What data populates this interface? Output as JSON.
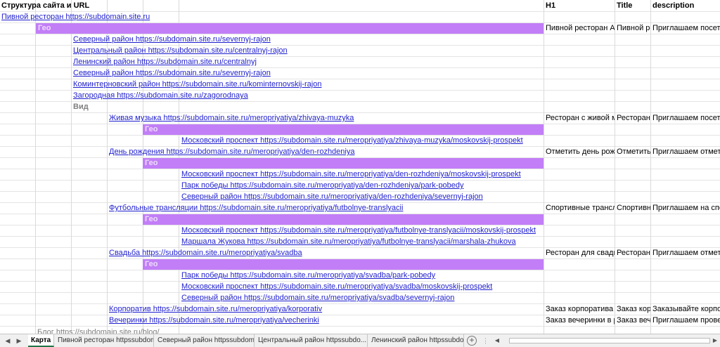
{
  "header": {
    "structure": "Структура сайта и URL",
    "h1": "H1",
    "title": "Title",
    "description": "description"
  },
  "root": {
    "link": "Пивной ресторан https://subdomain.site.ru",
    "geo_label": "Гео",
    "h1": "Пивной ресторан Ав",
    "title": "Пивной ре",
    "description": "Приглашаем посети"
  },
  "geo_links": [
    "Северный район https://subdomain.site.ru/severnyj-rajon",
    "Центральный район https://subdomain.site.ru/centralnyj-rajon",
    "Ленинский район https://subdomain.site.ru/centralnyj",
    "Северный район https://subdomain.site.ru/severnyj-rajon",
    "Коминтерновский район https://subdomain.site.ru/kominternovskij-rajon",
    "Загородная https://subdomain.site.ru/zagorodnaya"
  ],
  "vid_label": "Вид",
  "events": [
    {
      "link": "Живая музыка https://subdomain.site.ru/meropriyatiya/zhivaya-muzyka",
      "h1": "Ресторан с живой м",
      "title": "Ресторан",
      "description": "Приглашаем посети",
      "geo_label": "Гео",
      "geo": [
        "Московский проспект https://subdomain.site.ru/meropriyatiya/zhivaya-muzyka/moskovskij-prospekt"
      ]
    },
    {
      "link": "День рождения https://subdomain.site.ru/meropriyatiya/den-rozhdeniya",
      "h1": "Отметить день рож",
      "title": "Отметить",
      "description": "Приглашаем отмет",
      "geo_label": "Гео",
      "geo": [
        "Московский проспект https://subdomain.site.ru/meropriyatiya/den-rozhdeniya/moskovskij-prospekt",
        "Парк победы https://subdomain.site.ru/meropriyatiya/den-rozhdeniya/park-pobedy",
        "Северный район https://subdomain.site.ru/meropriyatiya/den-rozhdeniya/severnyj-rajon"
      ]
    },
    {
      "link": "Футбольные трансляции https://subdomain.site.ru/meropriyatiya/futbolnye-translyacii",
      "h1": "Спортивные трансл",
      "title": "Спортивн",
      "description": "Приглашаем на спо",
      "geo_label": "Гео",
      "geo": [
        "Московский проспект https://subdomain.site.ru/meropriyatiya/futbolnye-translyacii/moskovskij-prospekt",
        "Маршала Жукова https://subdomain.site.ru/meropriyatiya/futbolnye-translyacii/marshala-zhukova"
      ]
    },
    {
      "link": "Свадьба https://subdomain.site.ru/meropriyatiya/svadba",
      "h1": "Ресторан для свадь",
      "title": "Ресторан ,",
      "description": "Приглашаем отмет",
      "geo_label": "Гео",
      "geo": [
        "Парк победы https://subdomain.site.ru/meropriyatiya/svadba/park-pobedy",
        "Московский проспект https://subdomain.site.ru/meropriyatiya/svadba/moskovskij-prospekt",
        "Северный район https://subdomain.site.ru/meropriyatiya/svadba/severnyj-rajon"
      ]
    },
    {
      "link": "Корпоратив https://subdomain.site.ru/meropriyatiya/korporativ",
      "h1": "Заказ корпоратива в",
      "title": "Заказ кор",
      "description": "Заказывайте корпо"
    },
    {
      "link": "Вечеринки https://subdomain.site.ru/meropriyatiya/vecherinki",
      "h1": "Заказ вечеринки в р",
      "title": "Заказ веч",
      "description": "Приглашаем прове"
    }
  ],
  "blog_partial": "Блог https://subdomain.site.ru/blog/",
  "tabs": [
    "Карта",
    "Пивной ресторан httpssubdoma...",
    "Северный район httpssubdomai...",
    "Центральный район httpssubdo...",
    "Ленинский район httpssubdor"
  ],
  "active_tab": "Карта",
  "tab_bar": {
    "nav_prev_icon": "◀",
    "nav_next_icon": "▶",
    "add_icon": "+",
    "more_icon": "⋮",
    "scroll_left_icon": "◀",
    "scroll_right_icon": "▶"
  },
  "colors": {
    "geo_band": "#c27ef7",
    "link": "#1f1fcf",
    "muted": "#7f7f7f"
  }
}
